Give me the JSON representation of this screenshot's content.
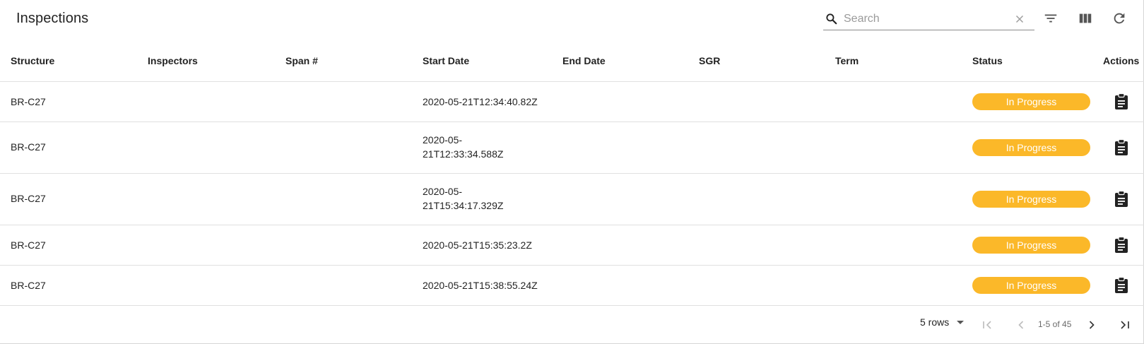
{
  "toolbar": {
    "title": "Inspections",
    "search_placeholder": "Search",
    "search_value": ""
  },
  "columns": [
    "Structure",
    "Inspectors",
    "Span #",
    "Start Date",
    "End Date",
    "SGR",
    "Term",
    "Status",
    "Actions"
  ],
  "rows": [
    {
      "structure": "BR-C27",
      "inspectors": "",
      "span": "",
      "start_date": "2020-05-21T12:34:40.82Z",
      "end_date": "",
      "sgr": "",
      "term": "",
      "status": "In Progress"
    },
    {
      "structure": "BR-C27",
      "inspectors": "",
      "span": "",
      "start_date": "2020-05-21T12:33:34.588Z",
      "end_date": "",
      "sgr": "",
      "term": "",
      "status": "In Progress"
    },
    {
      "structure": "BR-C27",
      "inspectors": "",
      "span": "",
      "start_date": "2020-05-21T15:34:17.329Z",
      "end_date": "",
      "sgr": "",
      "term": "",
      "status": "In Progress"
    },
    {
      "structure": "BR-C27",
      "inspectors": "",
      "span": "",
      "start_date": "2020-05-21T15:35:23.2Z",
      "end_date": "",
      "sgr": "",
      "term": "",
      "status": "In Progress"
    },
    {
      "structure": "BR-C27",
      "inspectors": "",
      "span": "",
      "start_date": "2020-05-21T15:38:55.24Z",
      "end_date": "",
      "sgr": "",
      "term": "",
      "status": "In Progress"
    }
  ],
  "pagination": {
    "rows_per_page": "5 rows",
    "range_label": "1-5 of 45"
  },
  "colors": {
    "status_in_progress": "#fbb829"
  },
  "icons": {
    "search": "search-icon",
    "clear": "close-icon",
    "filter": "filter-icon",
    "columns": "view-column-icon",
    "refresh": "refresh-icon",
    "action": "clipboard-icon"
  }
}
